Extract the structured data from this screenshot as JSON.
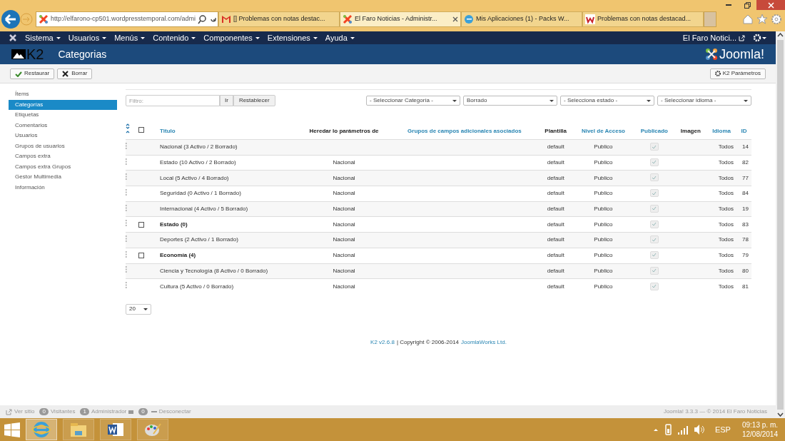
{
  "browser": {
    "address": "http://elfarono-cp501.wordpresstemporal.com/admi",
    "tabs": [
      {
        "title": "[] Problemas con notas destac...",
        "kind": "mail",
        "selected": false
      },
      {
        "title": "El Faro Noticias - Administr...",
        "kind": "joomla",
        "selected": true
      },
      {
        "title": "Mis Aplicaciones (1) - Packs W...",
        "kind": "ie",
        "selected": false
      },
      {
        "title": "Problemas con notas destacad...",
        "kind": "web",
        "selected": false
      }
    ]
  },
  "nav": {
    "menus": [
      "Sistema",
      "Usuarios",
      "Menús",
      "Contenido",
      "Componentes",
      "Extensiones",
      "Ayuda"
    ],
    "site": "El Faro Notici..."
  },
  "header": {
    "title": "Categorias",
    "logo": "K2",
    "brand": "Joomla!"
  },
  "toolbar": {
    "buttons": [
      {
        "label": "Restaurar",
        "kind": "check"
      },
      {
        "label": "Borrar",
        "kind": "x"
      }
    ],
    "options": "K2 Parámetros"
  },
  "sidebar": {
    "items": [
      {
        "label": "Ítems",
        "selected": false
      },
      {
        "label": "Categorías",
        "selected": true
      },
      {
        "label": "Etiquetas",
        "selected": false
      },
      {
        "label": "Comentarios",
        "selected": false
      },
      {
        "label": "Usuarios",
        "selected": false
      },
      {
        "label": "Grupos de usuarios",
        "selected": false
      },
      {
        "label": "Campos extra",
        "selected": false
      },
      {
        "label": "Campos extra Grupos",
        "selected": false
      },
      {
        "label": "Gestor Multimedia",
        "selected": false
      },
      {
        "label": "Información",
        "selected": false
      }
    ]
  },
  "filters": {
    "search_placeholder": "Filtro:",
    "go": "Ir",
    "reset": "Restablecer",
    "selects": [
      "- Seleccionar Categoría -",
      "Borrado",
      "- Selecciona estado -",
      "- Seleccionar idioma -"
    ]
  },
  "table": {
    "select_all_checked": false,
    "columns": [
      {
        "label": "Titulo",
        "sortable": true
      },
      {
        "label": "Heredar lo parámetros de",
        "sortable": false
      },
      {
        "label": "Grupos de campos adicionales asociados",
        "sortable": true
      },
      {
        "label": "Plantilla",
        "sortable": false
      },
      {
        "label": "Nivel de Acceso",
        "sortable": true
      },
      {
        "label": "Publicado",
        "sortable": true
      },
      {
        "label": "Imagen",
        "sortable": false
      },
      {
        "label": "Idioma",
        "sortable": true
      },
      {
        "label": "ID",
        "sortable": true
      }
    ],
    "rows": [
      {
        "kind": "trashed",
        "title": "Nacional (3 Activo / 2 Borrado)",
        "inherit": "",
        "template": "default",
        "access": "Publico",
        "published": true,
        "language": "Todos",
        "id": "14"
      },
      {
        "kind": "trashed",
        "title": "Estado (10 Activo / 2 Borrado)",
        "inherit": "Nacional",
        "template": "default",
        "access": "Publico",
        "published": true,
        "language": "Todos",
        "id": "82"
      },
      {
        "kind": "trashed",
        "title": "Local (5 Activo / 4 Borrado)",
        "inherit": "Nacional",
        "template": "default",
        "access": "Publico",
        "published": true,
        "language": "Todos",
        "id": "77"
      },
      {
        "kind": "trashed",
        "title": "Seguridad (0 Activo / 1 Borrado)",
        "inherit": "Nacional",
        "template": "default",
        "access": "Publico",
        "published": true,
        "language": "Todos",
        "id": "84"
      },
      {
        "kind": "trashed",
        "title": "Internacional (4 Activo / 5 Borrado)",
        "inherit": "Nacional",
        "template": "default",
        "access": "Publico",
        "published": true,
        "language": "Todos",
        "id": "19"
      },
      {
        "kind": "item",
        "checked": false,
        "title": "Estado (0)",
        "inherit": "Nacional",
        "template": "default",
        "access": "Publico",
        "published": true,
        "language": "Todos",
        "id": "83"
      },
      {
        "kind": "trashed",
        "title": "Deportes (2 Activo / 1 Borrado)",
        "inherit": "Nacional",
        "template": "default",
        "access": "Publico",
        "published": true,
        "language": "Todos",
        "id": "78"
      },
      {
        "kind": "item",
        "checked": false,
        "title": "Economía (4)",
        "inherit": "Nacional",
        "template": "default",
        "access": "Publico",
        "published": true,
        "language": "Todos",
        "id": "79"
      },
      {
        "kind": "trashed",
        "title": "Ciencia y Tecnología (8 Activo / 0 Borrado)",
        "inherit": "Nacional",
        "template": "default",
        "access": "Publico",
        "published": true,
        "language": "Todos",
        "id": "80"
      },
      {
        "kind": "trashed",
        "title": "Cultura (5 Activo / 0 Borrado)",
        "inherit": "Nacional",
        "template": "default",
        "access": "Publico",
        "published": true,
        "language": "Todos",
        "id": "81"
      }
    ]
  },
  "limit": "20",
  "credits": {
    "version": "K2 v2.6.8",
    "text": "| Copyright © 2006-2014",
    "company": "JoomlaWorks Ltd."
  },
  "status": {
    "view_site": "Ver sitio",
    "visitors_count": "0",
    "visitors": "Visitantes",
    "admins_count": "1",
    "admins": "Administrador",
    "messages_count": "0",
    "logout": "Desconectar",
    "right": "Joomla! 3.3.3 — © 2014 El Faro Noticias"
  },
  "taskbar": {
    "language": "ESP",
    "time": "09:13 p. m.",
    "date": "12/08/2014"
  }
}
